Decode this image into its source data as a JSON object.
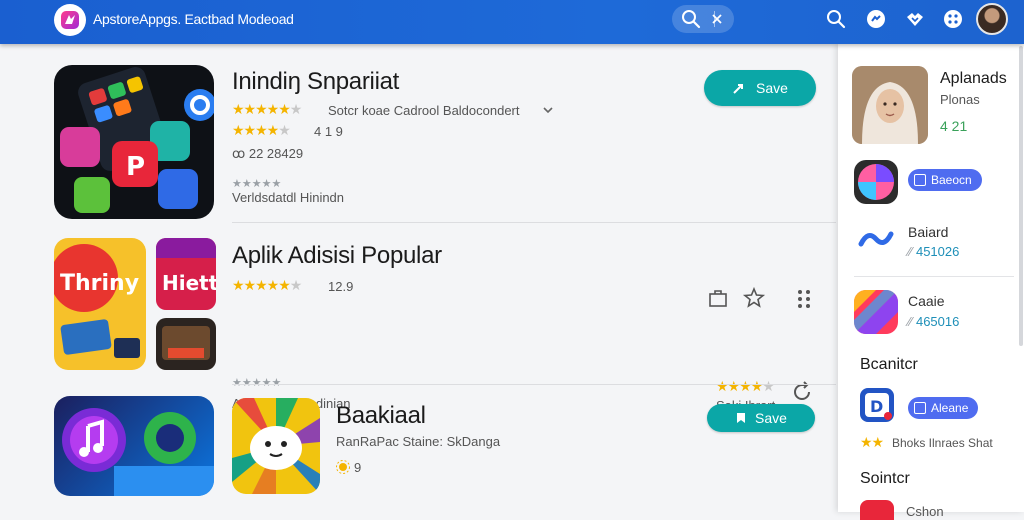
{
  "header": {
    "title": "ApstoreAppgs. Eactbad Modeoad",
    "logo_icon": "app-store-logo-icon",
    "icons": [
      "search-icon",
      "clear-icon",
      "search-icon",
      "chat-icon",
      "handshake-icon",
      "apps-icon"
    ]
  },
  "main": {
    "items": [
      {
        "title": "Inindiŋ Snpariiat",
        "rating_text": "Sotcr koae Cadrool Baldocondert",
        "rating2": "4 1 9",
        "meta": "ꝏ 22 28429",
        "category": "Verldsdatdl Hinindn",
        "button": "Save",
        "stars": 5
      },
      {
        "title": "Aplik Adisisi Popular",
        "rating": "12.9",
        "category": "Apling Sa blandinian",
        "tile_text_1": "Thriny",
        "tile_text_2": "Hiett",
        "side_rating_label": "Saki Ibrart",
        "stars": 5
      },
      {
        "title": "Baakiaal",
        "subtitle": "RanRaPac Staine: SkDanga",
        "rating": "9",
        "button": "Save"
      }
    ]
  },
  "sidebar": {
    "profile": {
      "name": "Aplanads",
      "sub": "Plonas",
      "score": "4 21"
    },
    "pill_1": "Baeocn",
    "item_1": {
      "name": "Baiard",
      "score": "451026"
    },
    "item_2": {
      "name": "Caaie",
      "score": "465016"
    },
    "section_1": "Bcanitcr",
    "pill_2": "Aleane",
    "rating_text": "Bhoks Ilnraes Shat",
    "section_2": "Sointcr",
    "footer_text": "Cshon"
  },
  "colors": {
    "topbar": "#1a5fd0",
    "accent_button": "#0ba7a7",
    "pill": "#4f6cf0",
    "star": "#f4b400",
    "score_green": "#3aa15a",
    "score_teal": "#1e8fb8"
  }
}
